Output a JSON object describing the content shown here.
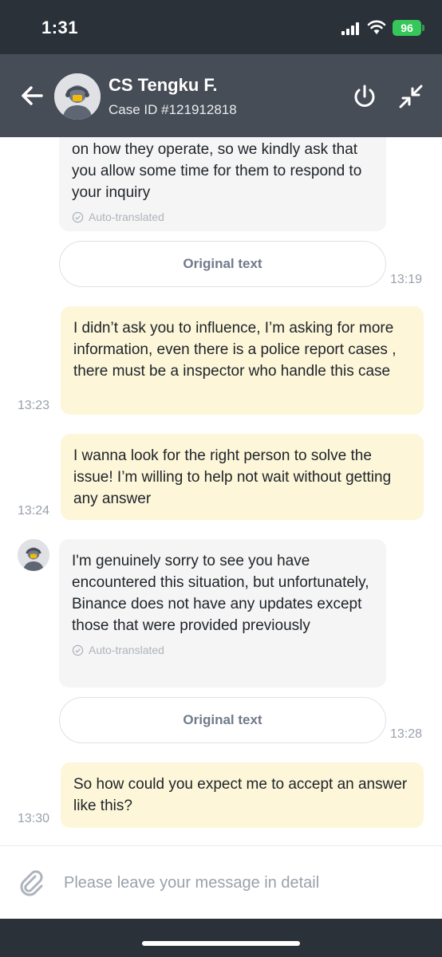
{
  "status_bar": {
    "time": "1:31",
    "battery": "96"
  },
  "header": {
    "agent_name": "CS Tengku F.",
    "case_id": "Case ID #121912818"
  },
  "messages": [
    {
      "sender": "agent",
      "text": "on how they operate, so we kindly ask that you allow some time for them to respond to your inquiry",
      "auto_translated": "Auto-translated",
      "original_button": "Original text",
      "time": "13:19"
    },
    {
      "sender": "user",
      "text": "I didn’t ask you to influence, I’m asking for more information, even there is a police report cases , there must be a inspector who handle this case",
      "time": "13:23"
    },
    {
      "sender": "user",
      "text": "I wanna look for the right person to solve the issue! I’m willing to help not wait without getting any answer",
      "time": "13:24"
    },
    {
      "sender": "agent",
      "text": "I'm genuinely sorry to see you have encountered this situation, but unfortunately, Binance does not have any updates except those that were provided previously",
      "auto_translated": "Auto-translated",
      "original_button": "Original text",
      "time": "13:28"
    },
    {
      "sender": "user",
      "text": "So how could you expect me to accept an answer like this?",
      "time": "13:30"
    }
  ],
  "input": {
    "placeholder": "Please leave your message in detail"
  },
  "colors": {
    "header_bg": "#474d57",
    "status_bg": "#2b3139",
    "user_bubble": "#fdf6d8",
    "agent_bubble": "#f5f5f5",
    "battery": "#35c759"
  }
}
